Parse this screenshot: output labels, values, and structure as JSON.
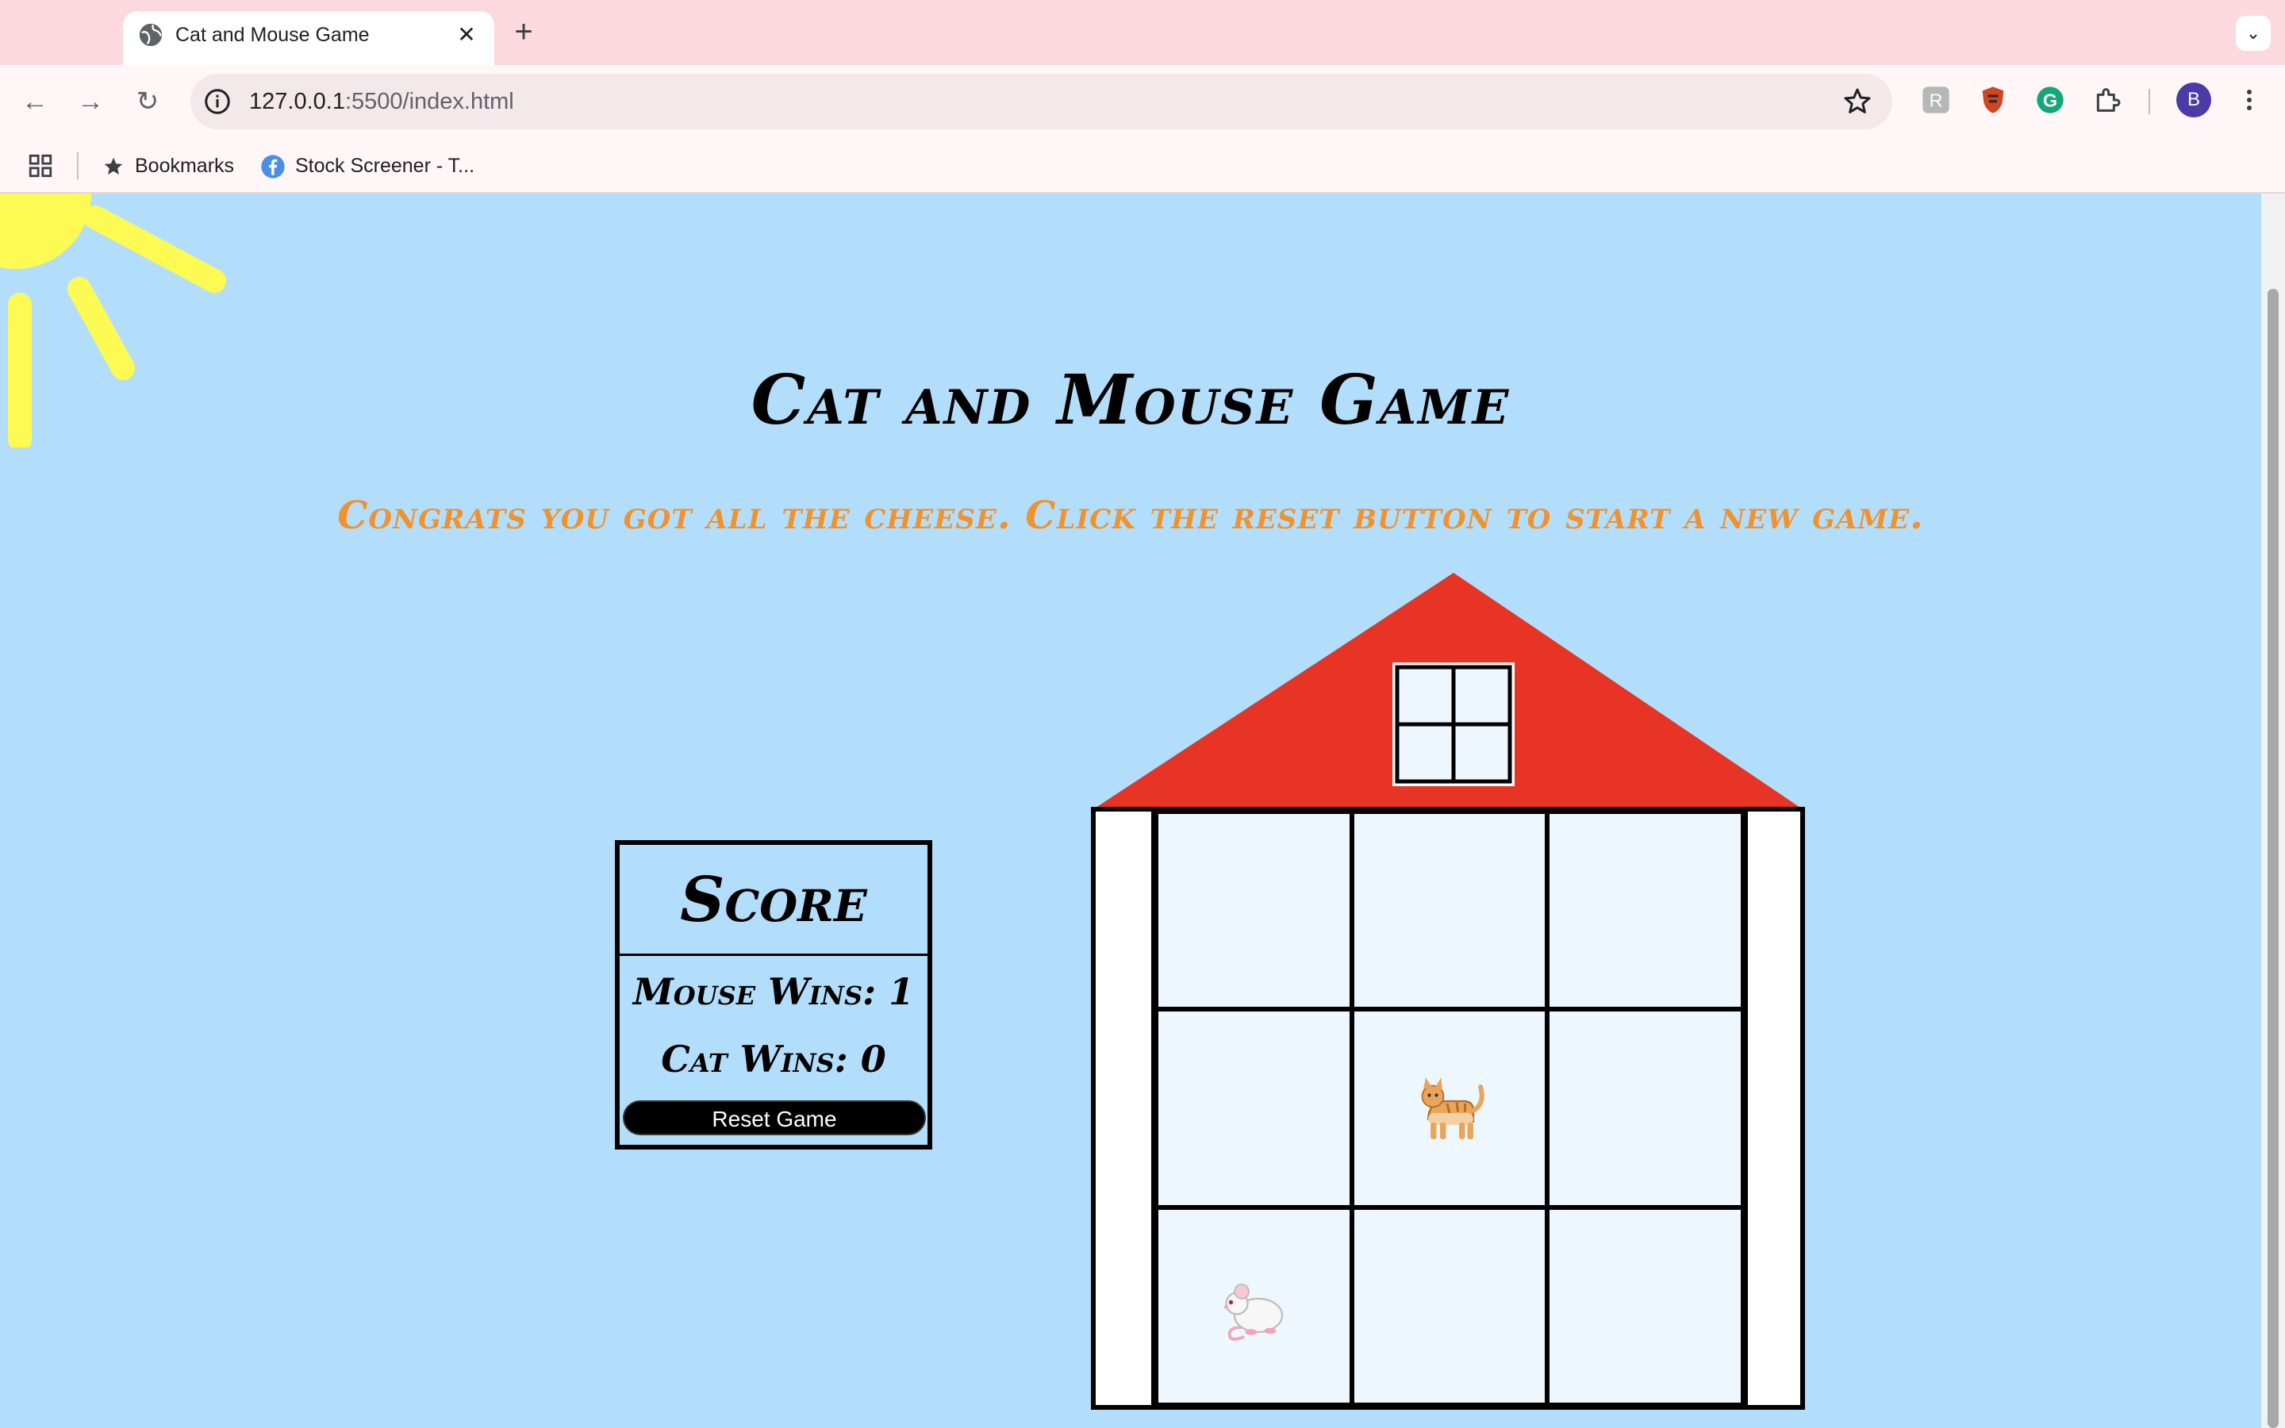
{
  "browser": {
    "tab_title": "Cat and Mouse Game",
    "url_host": "127.0.0.1",
    "url_rest": ":5500/index.html",
    "profile_initial": "B",
    "bookmarks": [
      {
        "label": "Bookmarks",
        "icon": "star-icon"
      },
      {
        "label": "Stock Screener - T...",
        "icon": "facebook-icon"
      }
    ]
  },
  "game": {
    "title": "Cat and Mouse Game",
    "message": "Congrats you got all the cheese. Click the reset button to start a new game.",
    "score": {
      "heading": "Score",
      "mouse_wins": "Mouse Wins: 1",
      "cat_wins": "Cat Wins: 0",
      "reset_label": "Reset Game"
    },
    "board": [
      [
        "",
        "",
        ""
      ],
      [
        "",
        "cat",
        ""
      ],
      [
        "mouse",
        "",
        ""
      ]
    ],
    "colors": {
      "sky": "#b3defb",
      "roof": "#e83424",
      "sun": "#fdfa53",
      "message": "#f0922e"
    }
  }
}
